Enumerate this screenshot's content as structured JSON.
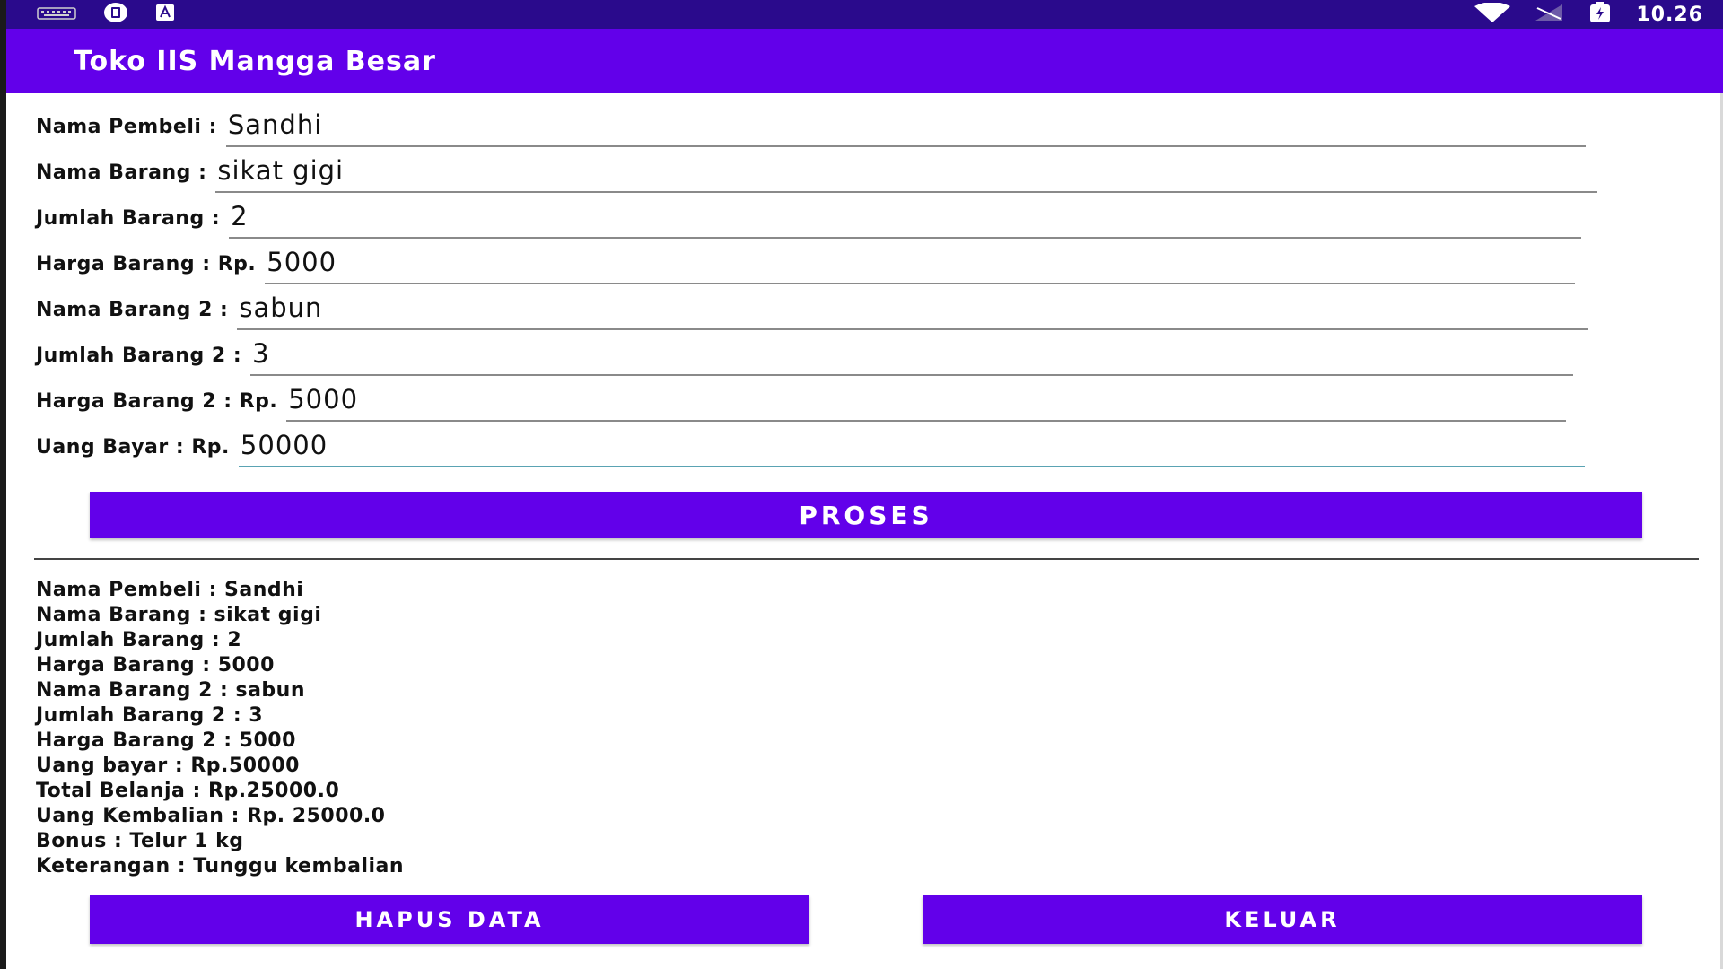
{
  "status_bar": {
    "left_icons": [
      "keyboard-icon",
      "notification-icon",
      "text-icon"
    ],
    "right_icons": [
      "wifi-icon",
      "signal-icon",
      "battery-icon"
    ],
    "time": "10.26"
  },
  "app_bar": {
    "title": "Toko IIS Mangga Besar"
  },
  "form": {
    "nama_pembeli": {
      "label": "Nama Pembeli :",
      "value": "Sandhi"
    },
    "nama_barang": {
      "label": "Nama Barang :",
      "value": "sikat gigi"
    },
    "jumlah_barang": {
      "label": "Jumlah Barang :",
      "value": "2"
    },
    "harga_barang": {
      "label": "Harga Barang : Rp.",
      "value": "5000"
    },
    "nama_barang_2": {
      "label": "Nama Barang 2 :",
      "value": "sabun"
    },
    "jumlah_barang_2": {
      "label": "Jumlah Barang 2 :",
      "value": "3"
    },
    "harga_barang_2": {
      "label": "Harga Barang 2 : Rp.",
      "value": "5000"
    },
    "uang_bayar": {
      "label": "Uang Bayar : Rp.",
      "value": "50000"
    }
  },
  "buttons": {
    "proses": "PROSES",
    "hapus_data": "HAPUS DATA",
    "keluar": "KELUAR"
  },
  "result": [
    "Nama Pembeli : Sandhi",
    "Nama Barang : sikat gigi",
    "Jumlah Barang : 2",
    "Harga Barang : 5000",
    "Nama Barang 2 : sabun",
    "Jumlah Barang 2 : 3",
    "Harga Barang 2 : 5000",
    "Uang bayar : Rp.50000",
    "Total Belanja : Rp.25000.0",
    "Uang Kembalian : Rp. 25000.0",
    "Bonus : Telur 1 kg",
    "Keterangan : Tunggu kembalian"
  ],
  "colors": {
    "app_bar": "#6200ea",
    "status_bar": "#2a0a8c",
    "button": "#6200ea",
    "focused_underline": "#5aa3b3"
  }
}
